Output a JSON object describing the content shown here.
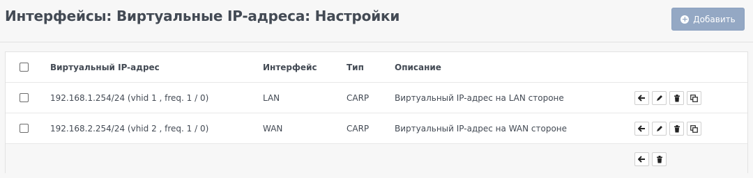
{
  "header": {
    "title": "Интерфейсы: Виртуальные IP-адреса: Настройки",
    "add_button_label": "Добавить"
  },
  "table": {
    "columns": {
      "address": "Виртуальный IP-адрес",
      "interface": "Интерфейс",
      "type": "Тип",
      "description": "Описание"
    },
    "rows": [
      {
        "address": "192.168.1.254/24 (vhid 1 , freq. 1 / 0)",
        "interface": "LAN",
        "type": "CARP",
        "description": "Виртуальный IP-адрес на LAN стороне"
      },
      {
        "address": "192.168.2.254/24 (vhid 2 , freq. 1 / 0)",
        "interface": "WAN",
        "type": "CARP",
        "description": "Виртуальный IP-адрес на WAN стороне"
      }
    ]
  },
  "icons": {
    "add": "plus-circle-icon",
    "move": "arrow-left-icon",
    "edit": "pencil-icon",
    "delete": "trash-icon",
    "clone": "copy-icon"
  },
  "colors": {
    "primary_button": "#94a8c4",
    "title": "#434a54",
    "background": "#f7f7f7"
  }
}
